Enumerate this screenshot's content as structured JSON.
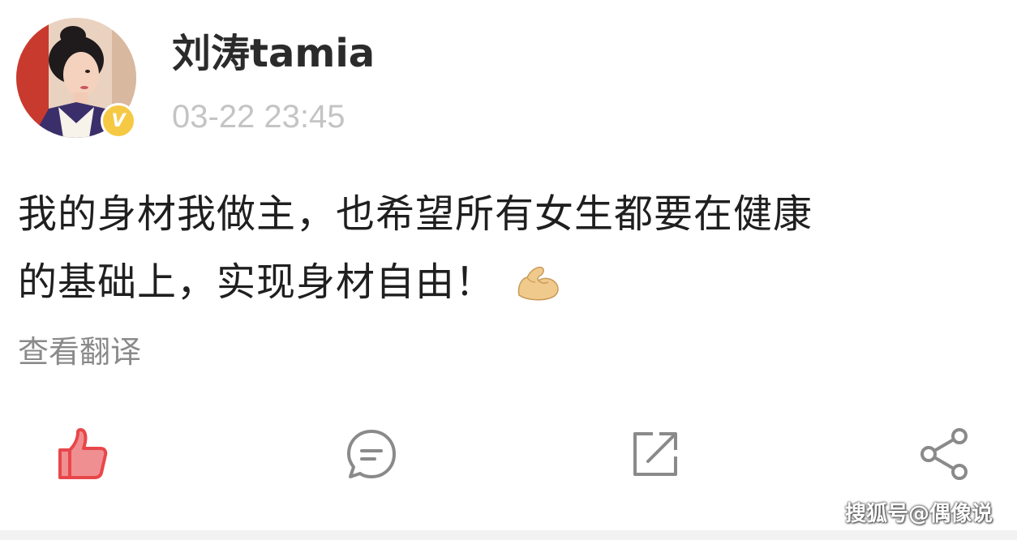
{
  "post": {
    "username": "刘涛tamia",
    "timestamp": "03-22 23:45",
    "content_line1": "我的身材我做主，也希望所有女生都要在健康",
    "content_line2": "的基础上，实现身材自由！",
    "content_emoji": "flexed-biceps",
    "translate_label": "查看翻译",
    "verified_badge": "V"
  },
  "actions": {
    "items": [
      {
        "name": "like",
        "icon": "thumbs-up-icon",
        "active": true,
        "color": "#e8474a"
      },
      {
        "name": "comment",
        "icon": "comment-bubble-icon",
        "active": false,
        "color": "#8a8a8a"
      },
      {
        "name": "repost",
        "icon": "repost-arrow-icon",
        "active": false,
        "color": "#8a8a8a"
      },
      {
        "name": "share",
        "icon": "share-nodes-icon",
        "active": false,
        "color": "#8a8a8a"
      }
    ]
  },
  "watermark": "搜狐号@偶像说",
  "colors": {
    "badge": "#f6c945",
    "like_active": "#e8474a",
    "icon_gray": "#8a8a8a",
    "timestamp_gray": "#c4c4c4"
  }
}
